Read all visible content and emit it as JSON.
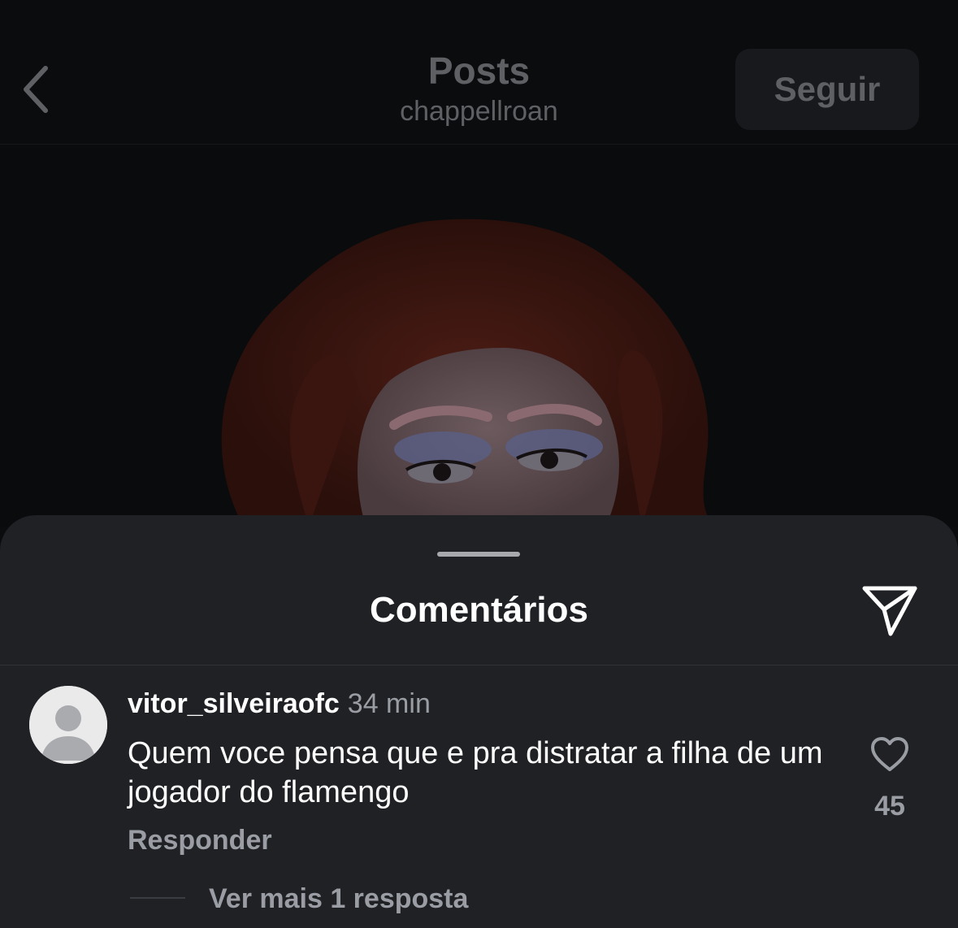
{
  "header": {
    "title": "Posts",
    "subtitle": "chappellroan",
    "follow_label": "Seguir",
    "back_icon": "chevron-left-icon"
  },
  "sheet": {
    "title": "Comentários",
    "share_icon": "send-icon"
  },
  "comment": {
    "username": "vitor_silveiraofc",
    "timestamp": "34 min",
    "text": "Quem voce pensa que e pra distratar a filha de um jogador do flamengo",
    "reply_label": "Responder",
    "like_count": "45",
    "view_replies_label": "Ver mais 1 resposta",
    "like_icon": "heart-outline-icon",
    "avatar_icon": "default-user-avatar-icon"
  },
  "colors": {
    "background": "#0b0c0e",
    "sheet": "#1f2125",
    "text_primary": "#ffffff",
    "text_secondary": "#9a9da3",
    "dimmed_header": "#5e6064"
  }
}
